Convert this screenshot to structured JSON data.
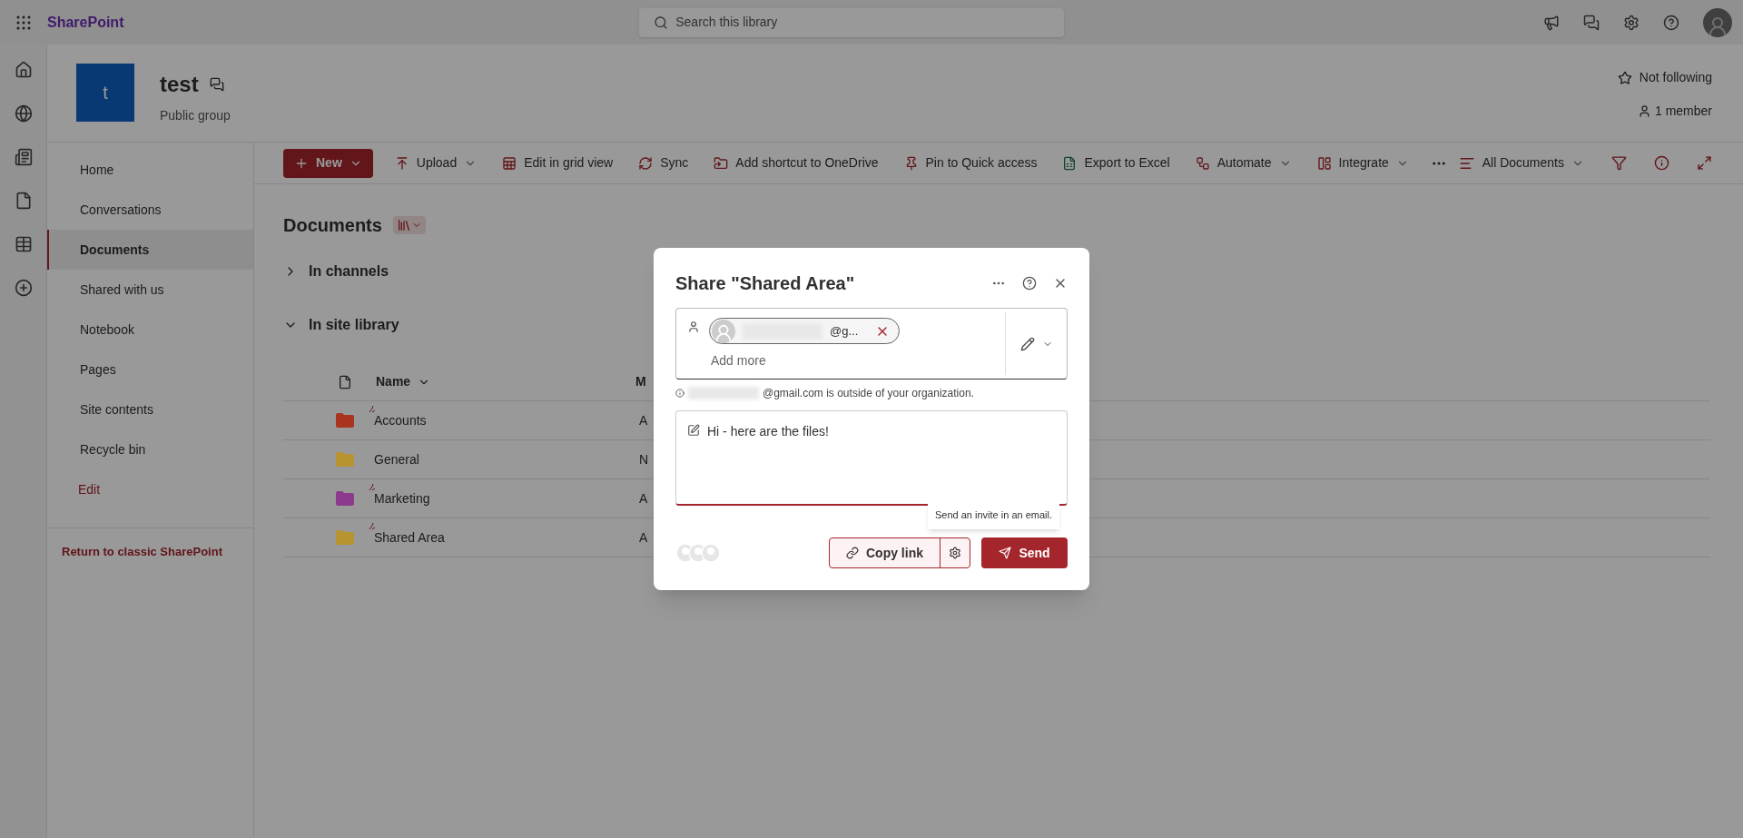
{
  "app_bar": {
    "brand": "SharePoint",
    "search": {
      "placeholder": "Search this library"
    }
  },
  "site": {
    "logo_letter": "t",
    "title": "test",
    "subtitle": "Public group",
    "follow": "Not following",
    "members": "1 member"
  },
  "nav": {
    "items": [
      {
        "label": "Home",
        "selected": false
      },
      {
        "label": "Conversations",
        "selected": false
      },
      {
        "label": "Documents",
        "selected": true
      },
      {
        "label": "Shared with us",
        "selected": false
      },
      {
        "label": "Notebook",
        "selected": false
      },
      {
        "label": "Pages",
        "selected": false
      },
      {
        "label": "Site contents",
        "selected": false
      },
      {
        "label": "Recycle bin",
        "selected": false
      }
    ],
    "edit": "Edit",
    "footer": "Return to classic SharePoint"
  },
  "command_bar": {
    "items": [
      {
        "kind": "new",
        "label": "New",
        "dropdown": true
      },
      {
        "kind": "upload",
        "label": "Upload",
        "dropdown": true
      },
      {
        "kind": "grid",
        "label": "Edit in grid view",
        "dropdown": false
      },
      {
        "kind": "sync",
        "label": "Sync",
        "dropdown": false
      },
      {
        "kind": "shortcut",
        "label": "Add shortcut to OneDrive",
        "dropdown": false
      },
      {
        "kind": "pin",
        "label": "Pin to Quick access",
        "dropdown": false
      },
      {
        "kind": "excel",
        "label": "Export to Excel",
        "dropdown": false
      },
      {
        "kind": "automate",
        "label": "Automate",
        "dropdown": true
      },
      {
        "kind": "integrate",
        "label": "Integrate",
        "dropdown": true
      }
    ],
    "view": "All Documents"
  },
  "library": {
    "title": "Documents",
    "sections": [
      {
        "label": "In channels",
        "expanded": false
      },
      {
        "label": "In site library",
        "expanded": true
      }
    ],
    "columns": [
      "Name",
      "M"
    ],
    "rows": [
      {
        "name": "Accounts",
        "color": "#a83420",
        "is_new": true,
        "column_2": "A"
      },
      {
        "name": "General",
        "color": "#b89430",
        "is_new": false,
        "column_2": "N"
      },
      {
        "name": "Marketing",
        "color": "#8e3a8c",
        "is_new": true,
        "column_2": "A"
      },
      {
        "name": "Shared Area",
        "color": "#b89430",
        "is_new": true,
        "column_2": "A"
      }
    ]
  },
  "dialog": {
    "title": "Share \"Shared Area\"",
    "recipient": "@g...",
    "add_more": "Add more",
    "notice": "@gmail.com is outside of your organization.",
    "message": "Hi - here are the files!",
    "tooltip": "Send an invite in an email.",
    "copy_link": "Copy link",
    "send": "Send"
  }
}
